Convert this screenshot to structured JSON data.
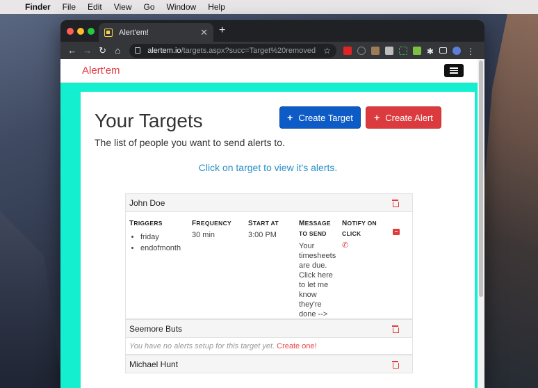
{
  "menubar": {
    "app_name": "Finder",
    "items": [
      "File",
      "Edit",
      "View",
      "Go",
      "Window",
      "Help"
    ]
  },
  "browser": {
    "tab_title": "Alert'em!",
    "url_host": "alertem.io",
    "url_path": "/targets.aspx?succ=Target%20removed"
  },
  "site": {
    "logo": "Alert'em"
  },
  "page": {
    "title": "Your Targets",
    "subtitle": "The list of people you want to send alerts to.",
    "create_target_label": "Create Target",
    "create_alert_label": "Create Alert",
    "hint": "Click on target to view it's alerts."
  },
  "columns": {
    "triggers": "Triggers",
    "frequency": "Frequency",
    "start_at": "Start At",
    "message_to_send": "Message To Send",
    "notify_on_click": "Notify On Click"
  },
  "targets": [
    {
      "name": "John Doe",
      "alert": {
        "triggers": [
          "friday",
          "endofmonth"
        ],
        "frequency": "30 min",
        "start_at": "3:00 PM",
        "message": "Your timesheets are due. Click here to let me know they're done -->"
      }
    },
    {
      "name": "Seemore Buts",
      "empty_text": "You have no alerts setup for this target yet.",
      "create_link": "Create one!"
    },
    {
      "name": "Michael Hunt"
    }
  ],
  "colors": {
    "teal_background": "#14f0cf",
    "primary_button": "#0d5bc6",
    "danger_button": "#db3b3f",
    "link_blue": "#2a8fc7",
    "accent_red": "#e03c3c"
  }
}
